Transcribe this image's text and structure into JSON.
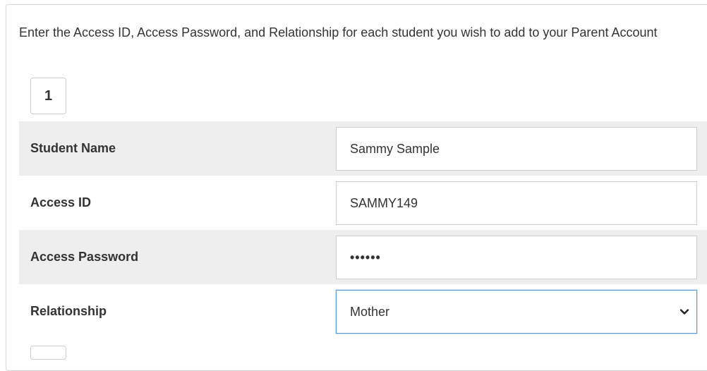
{
  "form": {
    "instructions": "Enter the Access ID, Access Password, and Relationship for each student you wish to add to your Parent Account",
    "step_number": "1",
    "fields": [
      {
        "label": "Student Name",
        "value": "Sammy Sample"
      },
      {
        "label": "Access ID",
        "value": "SAMMY149"
      },
      {
        "label": "Access Password",
        "value": "••••••"
      },
      {
        "label": "Relationship",
        "value": "Mother",
        "icon": "chevron-down-icon"
      }
    ]
  },
  "colors": {
    "row_shade": "#eeeeee",
    "focus_border": "#5b9bd5",
    "text": "#333333"
  }
}
